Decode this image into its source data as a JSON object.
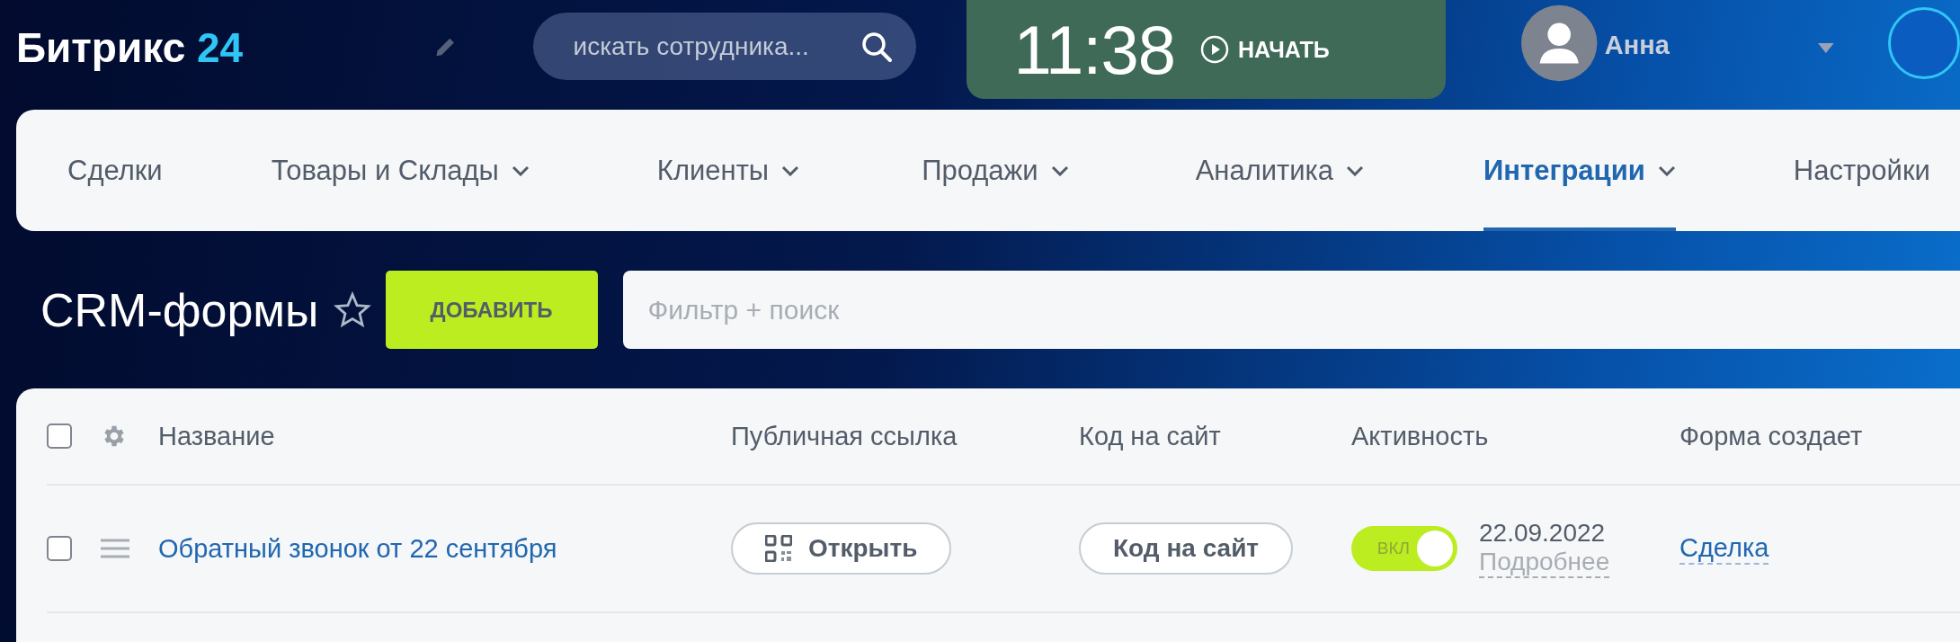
{
  "header": {
    "logo": {
      "name": "Битрикс",
      "number": "24"
    },
    "search": {
      "placeholder": "искать сотрудника..."
    },
    "timer": {
      "time": "11:38",
      "action": "НАЧАТЬ"
    },
    "user": {
      "name": "Анна"
    }
  },
  "nav": [
    {
      "label": "Сделки",
      "selected": false,
      "dropdown": false
    },
    {
      "label": "Товары и Склады",
      "selected": false,
      "dropdown": true
    },
    {
      "label": "Клиенты",
      "selected": false,
      "dropdown": true
    },
    {
      "label": "Продажи",
      "selected": false,
      "dropdown": true
    },
    {
      "label": "Аналитика",
      "selected": false,
      "dropdown": true
    },
    {
      "label": "Интеграции",
      "selected": true,
      "dropdown": true
    },
    {
      "label": "Настройки",
      "selected": false,
      "dropdown": false
    }
  ],
  "page": {
    "title": "CRM-формы",
    "add_button": "ДОБАВИТЬ",
    "filter": {
      "placeholder": "Фильтр + поиск"
    }
  },
  "table": {
    "all_checked": false,
    "columns": [
      "Название",
      "Публичная ссылка",
      "Код на сайт",
      "Активность",
      "Форма создает"
    ],
    "rows": [
      {
        "checked": false,
        "name": "Обратный звонок от 22 сентября",
        "open_button": "Открыть",
        "code_button": "Код на сайт",
        "active": true,
        "toggle_label": "ВКЛ",
        "date": "22.09.2022",
        "details": "Подробнее",
        "creates": "Сделка"
      }
    ]
  }
}
